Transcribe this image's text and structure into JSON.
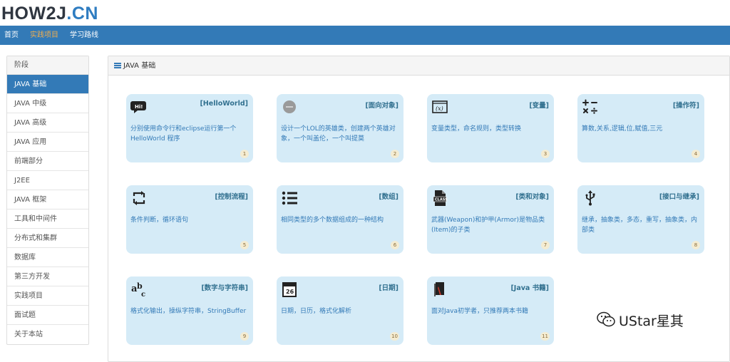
{
  "logo": {
    "part1": "HOW2J",
    "part2": ".CN"
  },
  "nav": {
    "items": [
      {
        "label": "首页",
        "active": false
      },
      {
        "label": "实践项目",
        "active": true
      },
      {
        "label": "学习路线",
        "active": false
      }
    ]
  },
  "sidebar": {
    "header": "阶段",
    "items": [
      {
        "label": "JAVA 基础",
        "active": true
      },
      {
        "label": "JAVA 中级"
      },
      {
        "label": "JAVA 高级"
      },
      {
        "label": "JAVA 应用"
      },
      {
        "label": "前端部分"
      },
      {
        "label": "J2EE"
      },
      {
        "label": "JAVA 框架"
      },
      {
        "label": "工具和中间件"
      },
      {
        "label": "分布式和集群"
      },
      {
        "label": "数据库"
      },
      {
        "label": "第三方开发"
      },
      {
        "label": "实践项目"
      },
      {
        "label": "面试题"
      },
      {
        "label": "关于本站"
      }
    ]
  },
  "panel": {
    "title": "JAVA 基础",
    "accent": "#337ab7",
    "cards": [
      {
        "title": "[HelloWorld]",
        "desc": "分别使用命令行和eclipse运行第一个HelloWorld 程序",
        "num": "1",
        "icon": "hello-speech-icon"
      },
      {
        "title": "[面向对象]",
        "desc": "设计一个LOL的英雄类，创建两个英雄对象，一个叫盖伦，一个叫提莫",
        "num": "2",
        "icon": "object-icon"
      },
      {
        "title": "[变量]",
        "desc": "变量类型，命名规则，类型转换",
        "num": "3",
        "icon": "variable-icon"
      },
      {
        "title": "[操作符]",
        "desc": "算数,关系,逻辑,位,赋值,三元",
        "num": "4",
        "icon": "operator-icon"
      },
      {
        "title": "[控制流程]",
        "desc": "条件判断，循环语句",
        "num": "5",
        "icon": "control-flow-icon"
      },
      {
        "title": "[数组]",
        "desc": "相同类型的多个数据组成的一种结构",
        "num": "6",
        "icon": "array-list-icon"
      },
      {
        "title": "[类和对象]",
        "desc": "武器(Weapon)和护甲(Armor)是物品类(Item)的子类",
        "num": "7",
        "icon": "class-file-icon"
      },
      {
        "title": "[接口与继承]",
        "desc": "继承，抽象类，多态，重写，抽象类，内部类",
        "num": "8",
        "icon": "usb-icon"
      },
      {
        "title": "[数字与字符串]",
        "desc": "格式化输出，操纵字符串，StringBuffer",
        "num": "9",
        "icon": "abc-icon"
      },
      {
        "title": "[日期]",
        "desc": "日期，日历，格式化解析",
        "num": "10",
        "icon": "calendar-icon"
      },
      {
        "title": "[Java 书籍]",
        "desc": "面对Java初学者，只推荐两本书籍",
        "num": "11",
        "icon": "book-icon"
      }
    ]
  },
  "watermark": {
    "text": "UStar星其"
  }
}
